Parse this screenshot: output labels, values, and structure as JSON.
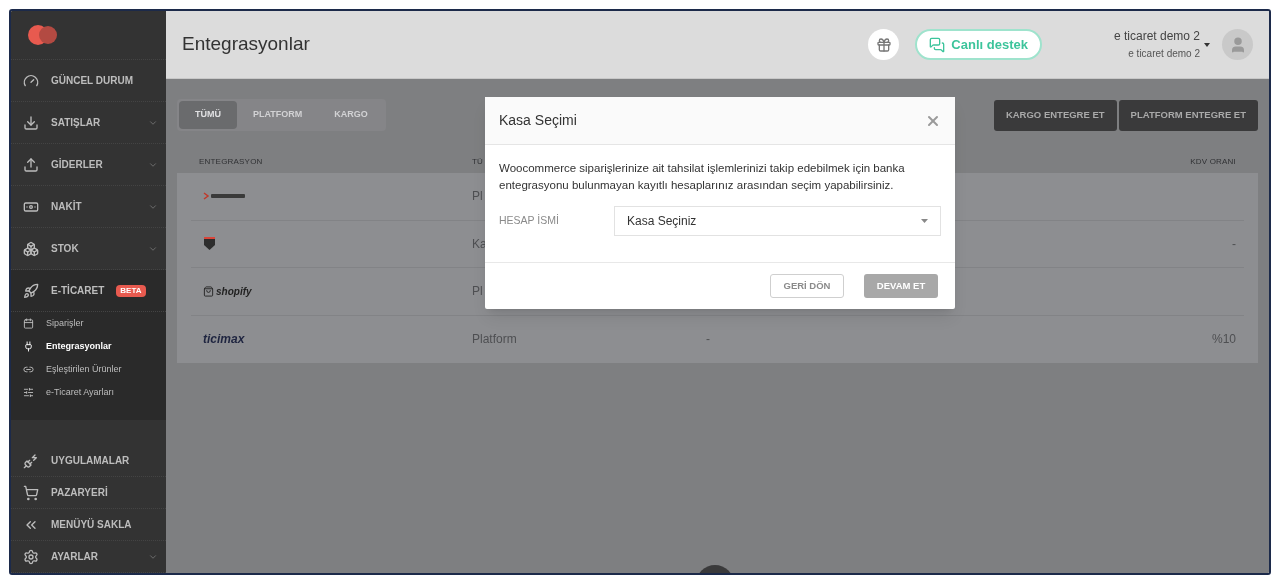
{
  "sidebar": {
    "items": [
      {
        "kind": "link",
        "label": "GÜNCEL DURUM"
      },
      {
        "kind": "group",
        "label": "SATIŞLAR",
        "expanded": false
      },
      {
        "kind": "group",
        "label": "GİDERLER",
        "expanded": false
      },
      {
        "kind": "group",
        "label": "NAKİT",
        "expanded": false
      },
      {
        "kind": "group",
        "label": "STOK",
        "expanded": false
      },
      {
        "kind": "group",
        "label": "E-TİCARET",
        "badge": "BETA",
        "expanded": true,
        "children": [
          {
            "label": "Siparişler",
            "selected": false
          },
          {
            "label": "Entegrasyonlar",
            "selected": true
          },
          {
            "label": "Eşleştirilen Ürünler",
            "selected": false
          },
          {
            "label": "e-Ticaret Ayarları",
            "selected": false
          }
        ]
      }
    ],
    "bottom_items": [
      {
        "kind": "link",
        "label": "UYGULAMALAR"
      },
      {
        "kind": "link",
        "label": "PAZARYERİ"
      },
      {
        "kind": "link",
        "label": "MENÜYÜ SAKLA"
      },
      {
        "kind": "group",
        "label": "AYARLAR",
        "expanded": false
      }
    ]
  },
  "header": {
    "title": "Entegrasyonlar",
    "support_button": "Canlı destek",
    "user": {
      "name": "e ticaret demo 2",
      "company": "e ticaret demo 2"
    }
  },
  "tabs": [
    {
      "label": "TÜMÜ",
      "selected": true
    },
    {
      "label": "PLATFORM",
      "selected": false
    },
    {
      "label": "KARGO",
      "selected": false
    }
  ],
  "actions": [
    "KARGO ENTEGRE ET",
    "PLATFORM ENTEGRE ET"
  ],
  "table": {
    "columns": [
      "ENTEGRASYON",
      "TÜ",
      "KDV ORANI"
    ],
    "rows": [
      {
        "logo": {
          "kind": "cart"
        },
        "type": "Pl",
        "column_3": "",
        "vat": ""
      },
      {
        "logo": {
          "kind": "shield"
        },
        "type": "Ka",
        "column_3": "",
        "vat": "-"
      },
      {
        "logo": {
          "kind": "bag",
          "text": "shopify"
        },
        "type": "Pl",
        "column_3": "",
        "vat": ""
      },
      {
        "logo": {
          "kind": "wordmark",
          "text": "ticimax"
        },
        "type": "Platform",
        "column_3": "-",
        "vat": "%10"
      }
    ]
  },
  "modal": {
    "title": "Kasa Seçimi",
    "message": "Woocommerce siparişlerinize ait tahsilat işlemlerinizi takip edebilmek için banka entegrasyonu bulunmayan kayıtlı hesaplarınız arasından seçim yapabilirsiniz.",
    "field": {
      "label": "HESAP İSMİ",
      "value": "Kasa Seçiniz"
    },
    "buttons": [
      {
        "label": "GERİ DÖN",
        "kind": "secondary",
        "disabled": false
      },
      {
        "label": "DEVAM ET",
        "kind": "primary",
        "disabled": true
      }
    ]
  }
}
